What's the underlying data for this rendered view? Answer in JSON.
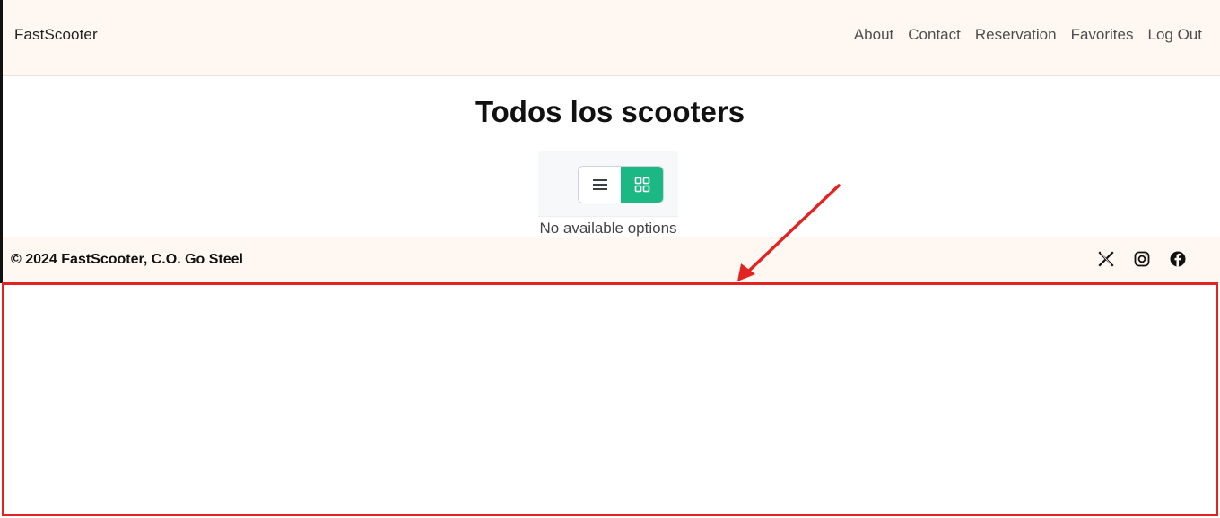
{
  "navbar": {
    "brand": "FastScooter",
    "links": [
      "About",
      "Contact",
      "Reservation",
      "Favorites",
      "Log Out"
    ]
  },
  "main": {
    "title": "Todos los scooters",
    "empty_message": "No available options",
    "view_toggle": {
      "options": [
        "list-icon",
        "grid-icon"
      ],
      "active": "grid-icon"
    }
  },
  "footer": {
    "copyright": "© 2024 FastScooter, C.O. Go Steel",
    "social_icons": [
      "x-icon",
      "instagram-icon",
      "facebook-icon"
    ]
  },
  "annotation": {
    "highlight_color": "#e32222"
  },
  "colors": {
    "header_bg": "#fff7f2",
    "accent": "#1cb884"
  }
}
